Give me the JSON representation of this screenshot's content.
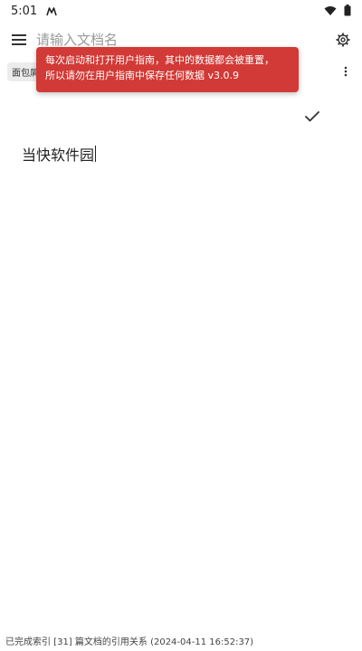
{
  "status_bar": {
    "time": "5:01",
    "icons": [
      "app-notification-icon",
      "wifi-icon",
      "battery-icon"
    ]
  },
  "top_bar": {
    "search_placeholder": "请输入文档名",
    "menu_icon": "hamburger-menu-icon",
    "settings_icon": "gear-icon"
  },
  "tab_row": {
    "chip_label": "面包屑",
    "more_icon": "more-vertical-icon"
  },
  "toast": {
    "line1": "每次启动和打开用户指南，其中的数据都会被重置，",
    "line2": "所以请勿在用户指南中保存任何数据 v3.0.9",
    "color": "#d13a36"
  },
  "editor": {
    "text": "当快软件园",
    "check_icon": "check-icon"
  },
  "footer": {
    "status_text": "已完成索引 [31] 篇文档的引用关系 (2024-04-11 16:52:37)"
  }
}
